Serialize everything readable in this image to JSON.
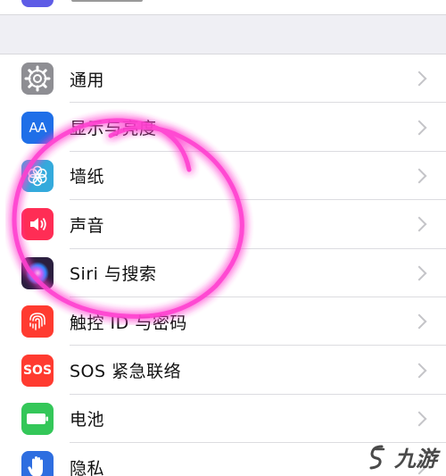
{
  "settings": {
    "items": [
      {
        "label": "通用",
        "icon": "gear-icon"
      },
      {
        "label": "显示与亮度",
        "icon": "display-brightness-icon",
        "icon_text": "AA"
      },
      {
        "label": "墙纸",
        "icon": "wallpaper-flower-icon"
      },
      {
        "label": "声音",
        "icon": "speaker-icon"
      },
      {
        "label": "Siri 与搜索",
        "icon": "siri-icon"
      },
      {
        "label": "触控 ID 与密码",
        "icon": "fingerprint-icon"
      },
      {
        "label": "SOS 紧急联络",
        "icon": "sos-icon",
        "icon_text": "SOS"
      },
      {
        "label": "电池",
        "icon": "battery-icon"
      },
      {
        "label": "隐私",
        "icon": "hand-icon"
      }
    ]
  },
  "watermark": {
    "text": "九游"
  },
  "colors": {
    "background": "#efeff4",
    "highlight_circle": "#ff4fd8"
  }
}
